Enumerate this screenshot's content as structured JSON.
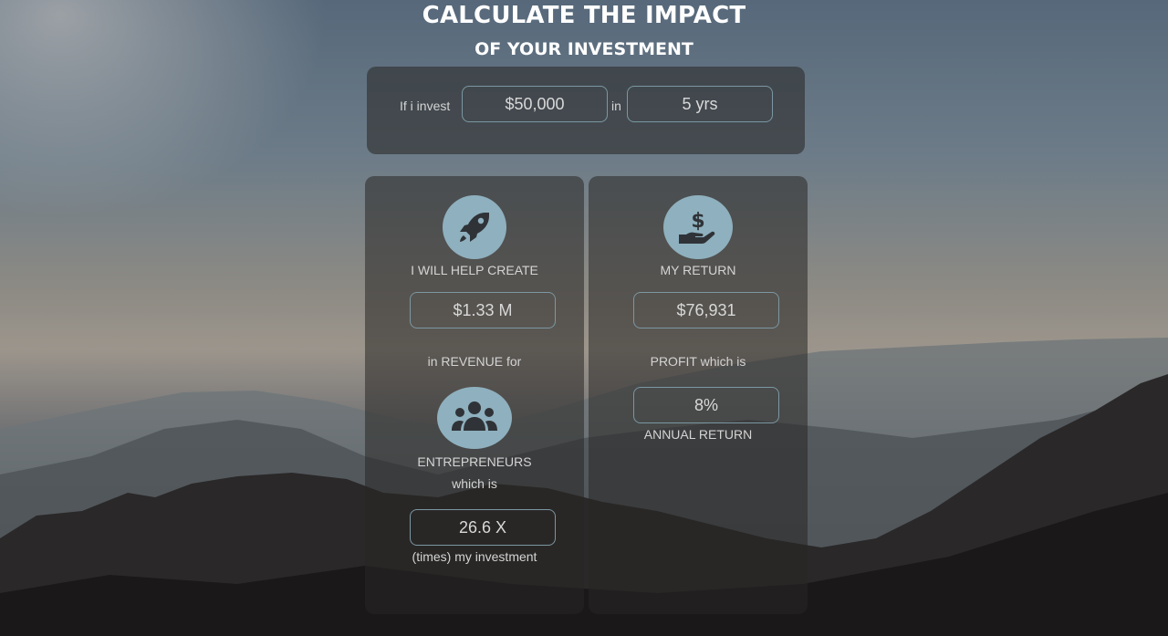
{
  "heading": {
    "title": "CALCULATE THE IMPACT",
    "subtitle": "OF YOUR INVESTMENT"
  },
  "invest": {
    "prefix_label": "If i invest",
    "amount": "$50,000",
    "in_label": "in",
    "years": "5 yrs"
  },
  "create_card": {
    "icon": "rocket-icon",
    "title": "I WILL HELP CREATE",
    "revenue_value": "$1.33 M",
    "revenue_label": "in REVENUE for",
    "people_icon": "users-group-icon",
    "entrepreneurs_label": "ENTREPRENEURS",
    "which_is_label": "which is",
    "multiplier_value": "26.6 X",
    "multiplier_label": "(times) my investment"
  },
  "return_card": {
    "icon": "money-hand-icon",
    "title": "MY RETURN",
    "return_value": "$76,931",
    "profit_label": "PROFIT which is",
    "annual_value": "8%",
    "annual_label": "ANNUAL RETURN"
  },
  "colors": {
    "accent_border": "#7b97a2",
    "icon_circle": "#8fb0be",
    "icon_glyph": "#2f3338"
  }
}
